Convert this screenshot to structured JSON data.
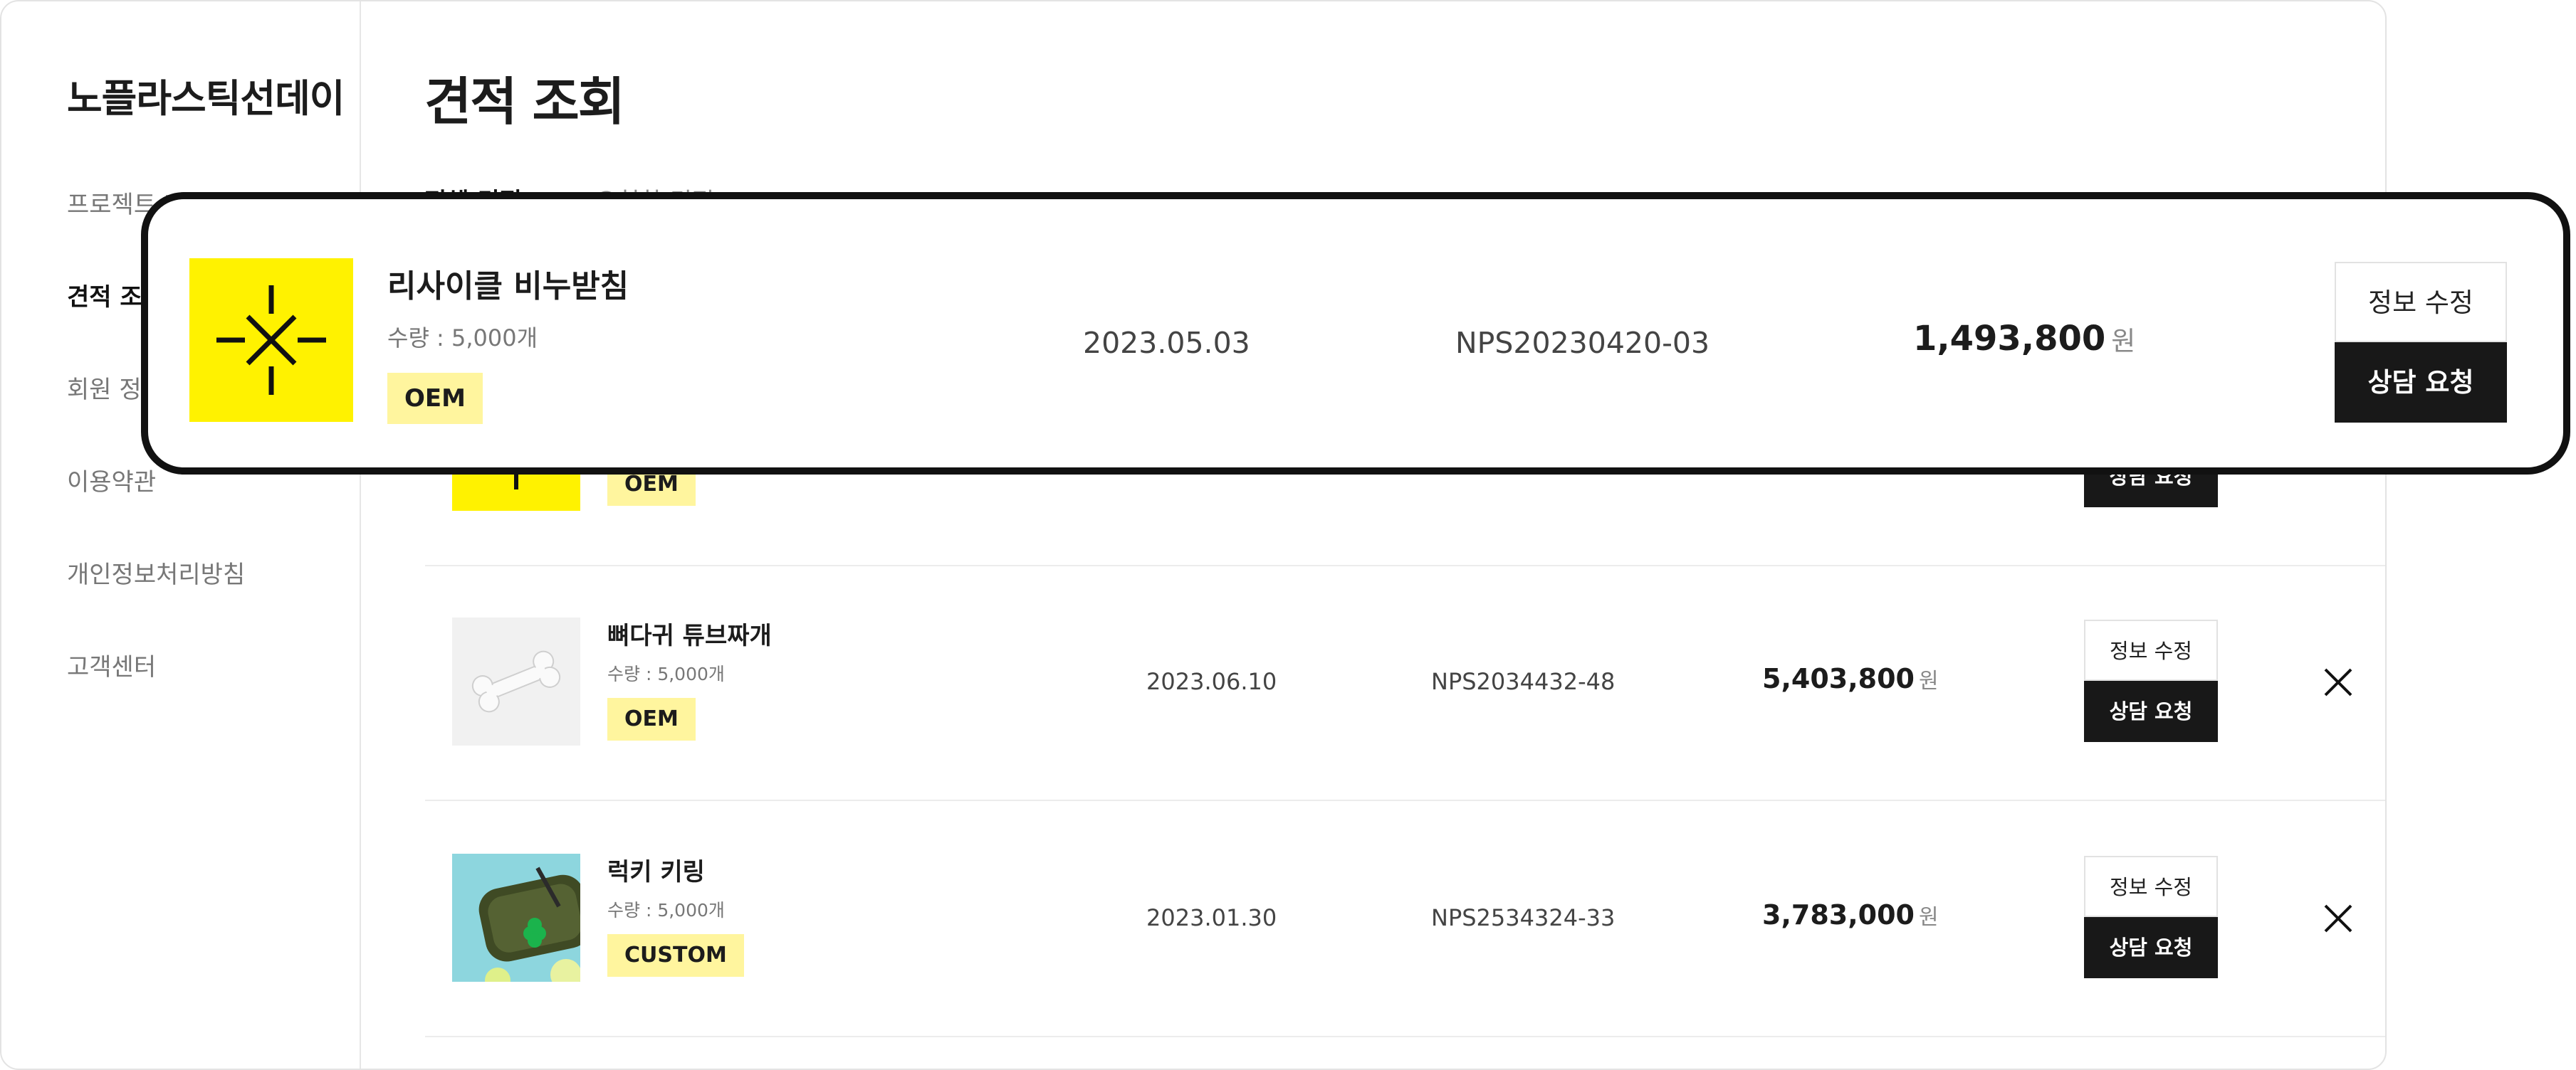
{
  "sidebar": {
    "brand": "노플라스틱선데이",
    "items": [
      {
        "label": "프로젝트 내역 조회"
      },
      {
        "label": "견적 조회"
      },
      {
        "label": "회원 정보"
      },
      {
        "label": "이용약관"
      },
      {
        "label": "개인정보처리방침"
      },
      {
        "label": "고객센터"
      }
    ]
  },
  "main": {
    "title": "견적 조회",
    "filters": [
      {
        "label": "전체 견적"
      },
      {
        "label": "요청한 견적"
      }
    ],
    "rows": [
      {
        "name": "",
        "qty": "",
        "tag": "OEM",
        "date": "",
        "code": "",
        "price": "",
        "unit": "원",
        "edit_label": "정보 수정",
        "consult_label": "상담 요청",
        "thumb_icon": "recycle-star-icon"
      },
      {
        "name": "뼈다귀 튜브짜개",
        "qty": "수량 : 5,000개",
        "tag": "OEM",
        "date": "2023.06.10",
        "code": "NPS2034432-48",
        "price": "5,403,800",
        "unit": "원",
        "edit_label": "정보 수정",
        "consult_label": "상담 요청",
        "thumb_icon": "bone-image"
      },
      {
        "name": "럭키 키링",
        "qty": "수량 : 5,000개",
        "tag": "CUSTOM",
        "date": "2023.01.30",
        "code": "NPS2534324-33",
        "price": "3,783,000",
        "unit": "원",
        "edit_label": "정보 수정",
        "consult_label": "상담 요청",
        "thumb_icon": "keyring-photo"
      }
    ]
  },
  "overlay": {
    "name": "리사이클 비누받침",
    "qty": "수량 : 5,000개",
    "tag": "OEM",
    "date": "2023.05.03",
    "code": "NPS20230420-03",
    "price": "1,493,800",
    "unit": "원",
    "edit_label": "정보 수정",
    "consult_label": "상담 요청",
    "thumb_icon": "recycle-star-icon"
  },
  "colors": {
    "accent_yellow": "#fff200",
    "tag_yellow": "#fff59e",
    "button_dark": "#181818",
    "border": "#e3e3e3"
  }
}
